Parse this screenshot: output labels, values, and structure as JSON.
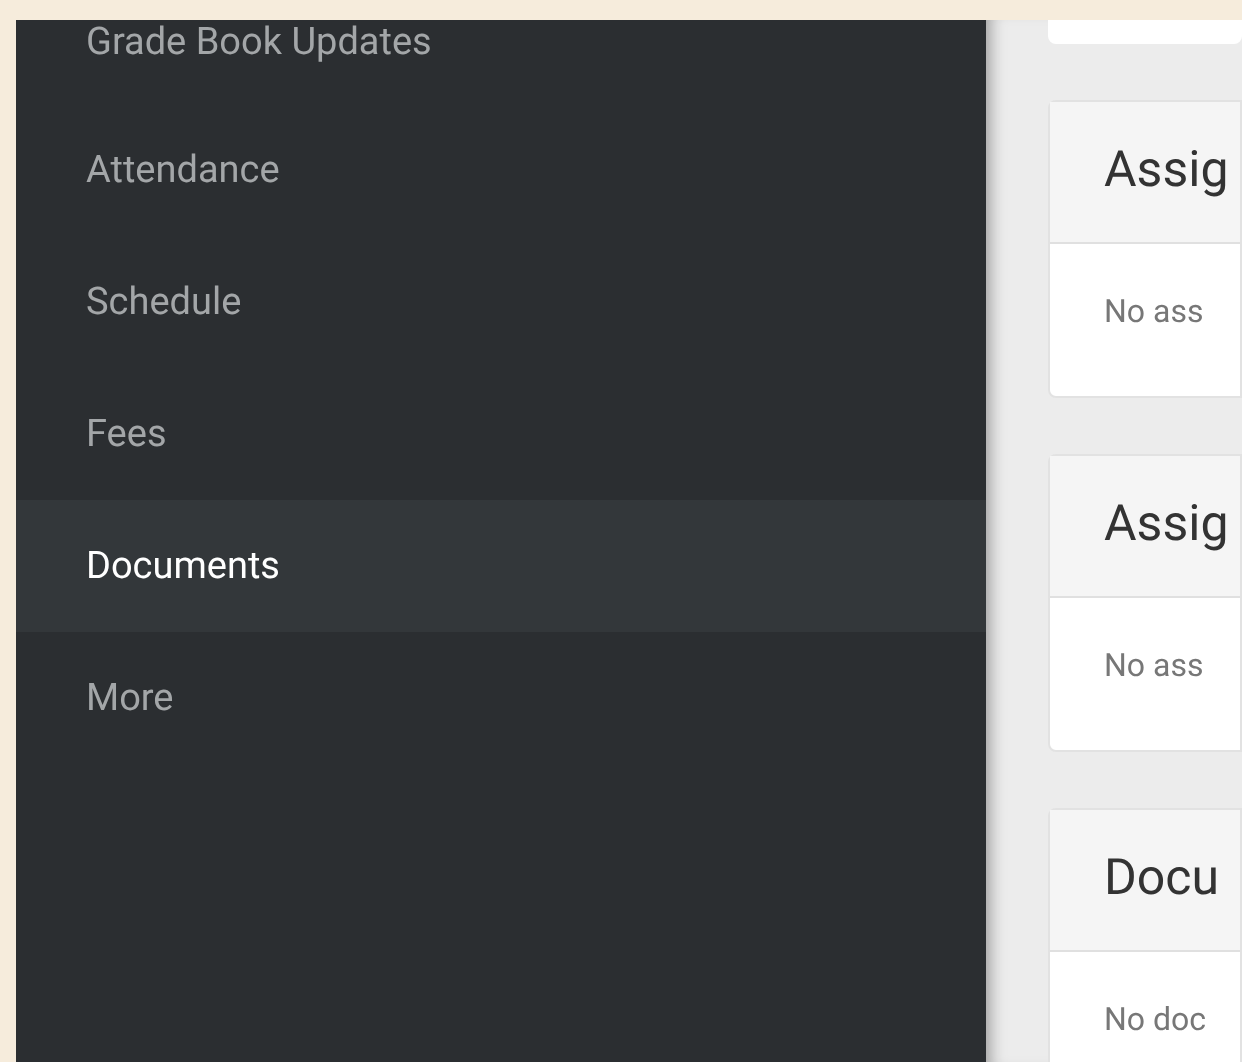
{
  "sidebar": {
    "items": [
      {
        "label": "Grade Book Updates",
        "selected": false
      },
      {
        "label": "Attendance",
        "selected": false
      },
      {
        "label": "Schedule",
        "selected": false
      },
      {
        "label": "Fees",
        "selected": false
      },
      {
        "label": "Documents",
        "selected": true
      },
      {
        "label": "More",
        "selected": false
      }
    ]
  },
  "cards": [
    {
      "title": "Assig",
      "body": "No ass"
    },
    {
      "title": "Assig",
      "body": "No ass"
    },
    {
      "title": "Docu",
      "body": "No doc"
    }
  ]
}
